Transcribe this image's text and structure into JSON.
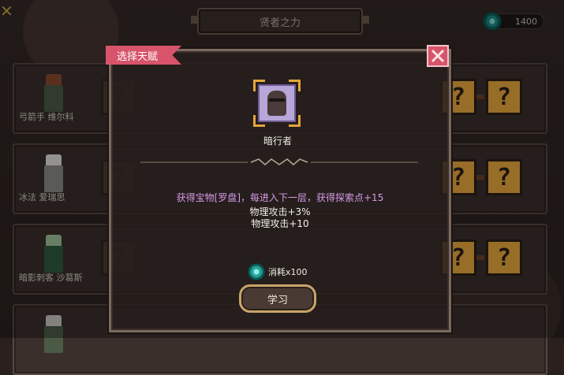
{
  "header": {
    "title": "贤者之力"
  },
  "currency": {
    "amount": "1400",
    "icon": "gem-icon"
  },
  "rows": [
    {
      "name": "弓箭手 维尔科"
    },
    {
      "name": "冰法 爱瑞思"
    },
    {
      "name": "暗影刺客 沙葛斯"
    }
  ],
  "modal": {
    "tab_label": "选择天赋",
    "talent_name": "暗行者",
    "effects": [
      "获得宝物[罗盘]，每进入下一层，获得探索点+15",
      "物理攻击+3%",
      "物理攻击+10"
    ],
    "cost_label": "消耗x100",
    "learn_label": "学习"
  },
  "colors": {
    "accent_pink": "#d8546b",
    "gold": "#e9a83e",
    "purple_text": "#d79ae8"
  },
  "question_mark": "?"
}
